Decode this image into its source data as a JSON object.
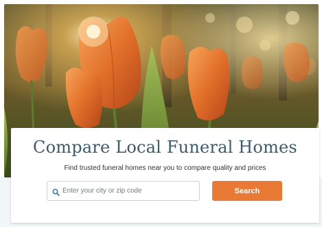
{
  "hero": {
    "image": "orange-tulips-sunlit-photo"
  },
  "card": {
    "title": "Compare Local Funeral Homes",
    "subtitle": "Find trusted funeral homes near you to compare quality and prices"
  },
  "search": {
    "icon": "search-icon",
    "placeholder": "Enter your city or zip code",
    "value": ""
  },
  "button": {
    "label": "Search"
  },
  "colors": {
    "accent": "#e97a35",
    "title": "#3d5a6b",
    "band": "#f1f6f8"
  }
}
